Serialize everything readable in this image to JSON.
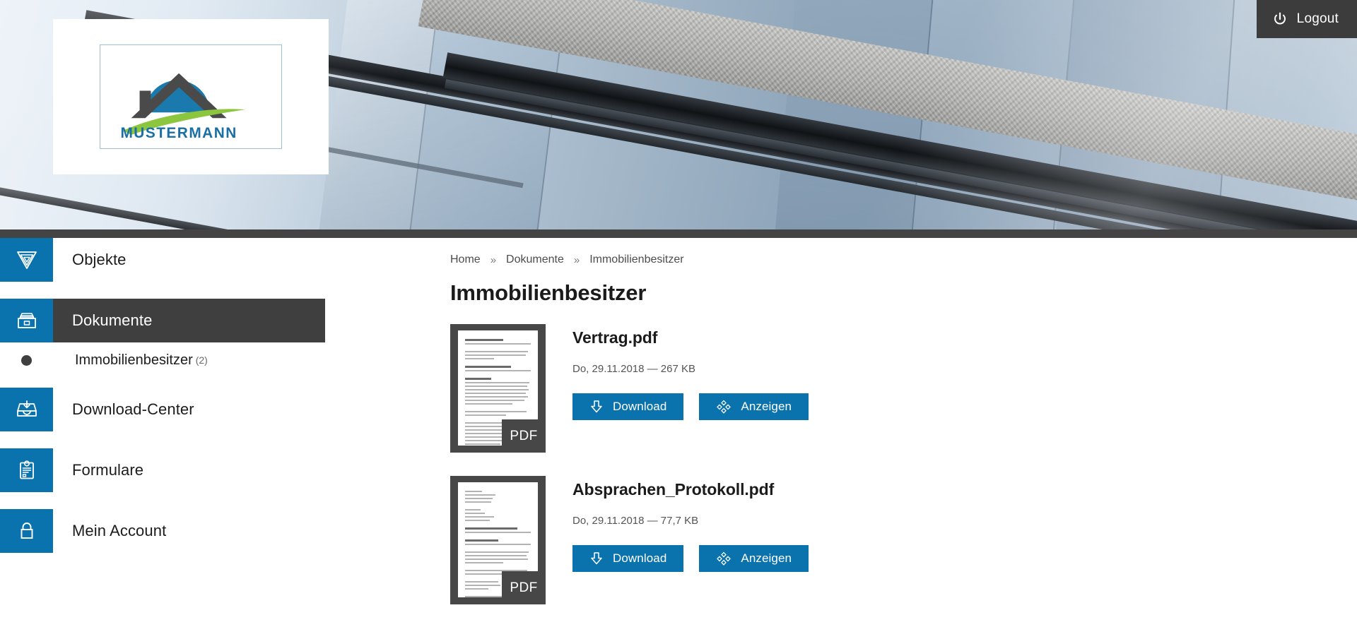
{
  "header": {
    "logo_text": "MUSTERMANN",
    "logout_label": "Logout"
  },
  "sidebar": {
    "items": [
      {
        "label": "Objekte",
        "icon": "funnel-triangle-icon",
        "active": false
      },
      {
        "label": "Dokumente",
        "icon": "file-drawer-icon",
        "active": true
      },
      {
        "label": "Download-Center",
        "icon": "inbox-download-icon",
        "active": false
      },
      {
        "label": "Formulare",
        "icon": "clipboard-icon",
        "active": false
      },
      {
        "label": "Mein Account",
        "icon": "lock-icon",
        "active": false
      }
    ],
    "sub_item": {
      "label": "Immobilienbesitzer",
      "count": "(2)"
    }
  },
  "breadcrumb": {
    "separator": "»",
    "items": [
      "Home",
      "Dokumente",
      "Immobilienbesitzer"
    ]
  },
  "main": {
    "title": "Immobilienbesitzer",
    "documents": [
      {
        "name": "Vertrag.pdf",
        "meta": "Do, 29.11.2018 — 267 KB",
        "type_badge": "PDF",
        "download_label": "Download",
        "view_label": "Anzeigen"
      },
      {
        "name": "Absprachen_Protokoll.pdf",
        "meta": "Do, 29.11.2018 — 77,7 KB",
        "type_badge": "PDF",
        "download_label": "Download",
        "view_label": "Anzeigen"
      }
    ]
  },
  "colors": {
    "accent_blue": "#0a72ac",
    "logo_blue": "#1a7aad",
    "logo_green": "#8cc63f",
    "logo_gray": "#4a4a4a",
    "dark_bar": "#3f3f3f",
    "hero_strip": "#444444"
  }
}
